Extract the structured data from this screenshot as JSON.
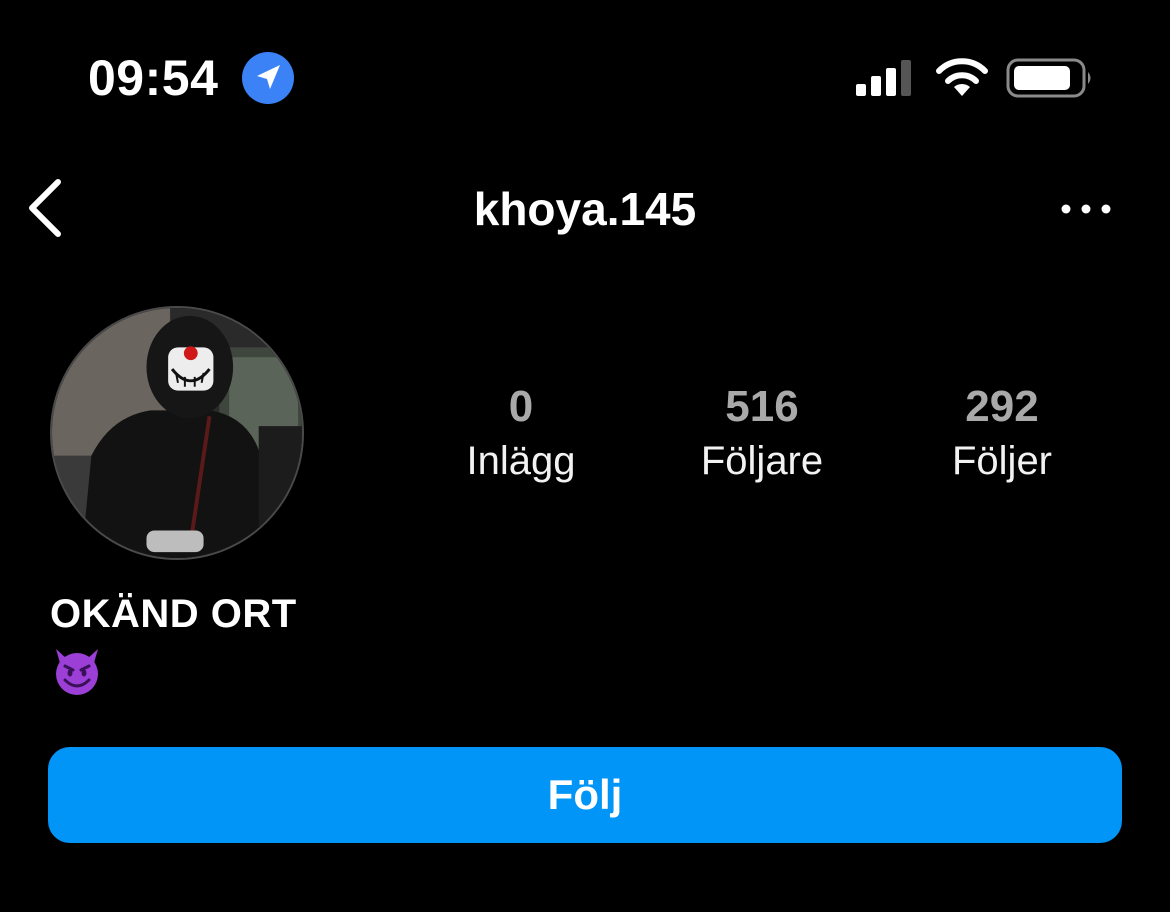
{
  "status_bar": {
    "time": "09:54",
    "icons": [
      "location-arrow-icon",
      "cellular-signal-icon",
      "wifi-icon",
      "battery-icon"
    ]
  },
  "header": {
    "username": "khoya.145",
    "icons": [
      "chevron-left-icon",
      "more-options-icon"
    ]
  },
  "profile": {
    "stats": [
      {
        "value": "0",
        "label": "Inlägg"
      },
      {
        "value": "516",
        "label": "Följare"
      },
      {
        "value": "292",
        "label": "Följer"
      }
    ],
    "display_name": "OKÄND ORT",
    "bio_emoji": "smiling-face-with-horns"
  },
  "actions": {
    "follow_label": "Följ"
  },
  "colors": {
    "background": "#000000",
    "accent": "#0095f6",
    "location": "#3b82f6",
    "stat_value": "#a9a9a9",
    "emoji": "#9b3fd6"
  }
}
